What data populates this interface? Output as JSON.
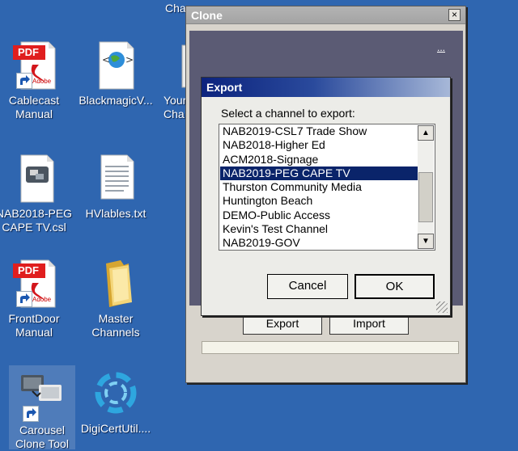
{
  "desktop": {
    "top_partial_label": "Cha",
    "icons": [
      {
        "name": "cablecast-manual",
        "label": "Cablecast\nManual",
        "badge": "PDF",
        "brand": "Adobe",
        "icon": "pdf-icon"
      },
      {
        "name": "blackmagic",
        "label": "BlackmagicV...",
        "icon": "web-file-icon"
      },
      {
        "name": "your-channels",
        "label": "Your\nCha",
        "icon": "window-icon"
      },
      {
        "name": "nab2018-peg",
        "label": "NAB2018-PEG\nCAPE TV.csl",
        "icon": "csl-file-icon"
      },
      {
        "name": "hvlables",
        "label": "HVlables.txt",
        "icon": "text-file-icon"
      },
      {
        "name": "frontdoor-manual",
        "label": "FrontDoor\nManual",
        "badge": "PDF",
        "brand": "Adobe",
        "icon": "pdf-icon"
      },
      {
        "name": "master-channels",
        "label": "Master\nChannels",
        "icon": "folder-icon"
      },
      {
        "name": "carousel-clone-tool",
        "label": "Carousel\nClone Tool",
        "icon": "app-icon"
      },
      {
        "name": "digicert",
        "label": "DigiCertUtil....",
        "icon": "digicert-icon"
      }
    ]
  },
  "clone_window": {
    "title": "Clone",
    "close_label": "×",
    "ellipsis": "...",
    "export_label": "Export",
    "import_label": "Import"
  },
  "export_dialog": {
    "title": "Export",
    "prompt": "Select a channel to export:",
    "channels": [
      "NAB2019-CSL7 Trade Show",
      "NAB2018-Higher Ed",
      "ACM2018-Signage",
      "NAB2019-PEG CAPE TV",
      "Thurston Community Media",
      "Huntington Beach",
      "DEMO-Public Access",
      "Kevin's Test Channel",
      "NAB2019-GOV"
    ],
    "selected_index": 3,
    "cancel_label": "Cancel",
    "ok_label": "OK",
    "scroll_up": "▲",
    "scroll_down": "▼"
  },
  "colors": {
    "desktop": "#2f66b0",
    "selection": "#0a246a",
    "title_gradient_start": "#0c237d"
  }
}
